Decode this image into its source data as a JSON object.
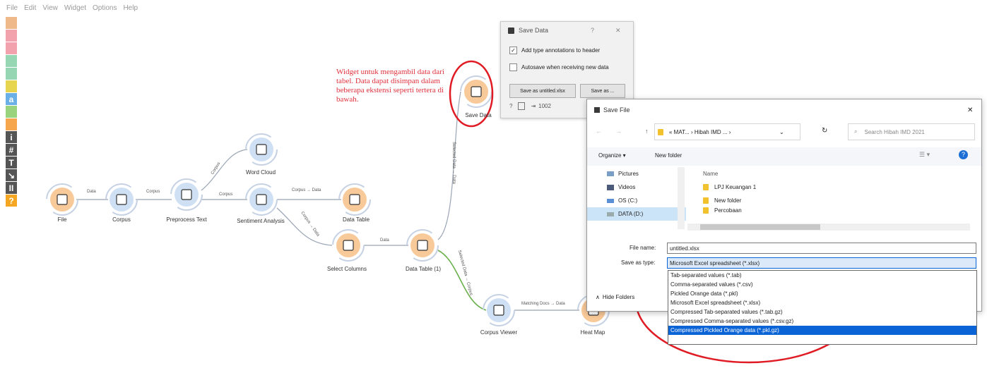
{
  "menu": [
    "File",
    "Edit",
    "View",
    "Widget",
    "Options",
    "Help"
  ],
  "toolbar_icons": [
    {
      "name": "table-icon",
      "color": "#f0b98a"
    },
    {
      "name": "draw-icon",
      "color": "#f1a2ac"
    },
    {
      "name": "hierarchy-icon",
      "color": "#f1a2ac"
    },
    {
      "name": "heatmap-icon",
      "color": "#96d6b3"
    },
    {
      "name": "tree-icon",
      "color": "#96d6b3"
    },
    {
      "name": "image-icon",
      "color": "#e7d54f"
    },
    {
      "name": "text-a-icon",
      "color": "#6ab0e6",
      "glyph": "a"
    },
    {
      "name": "network-icon",
      "color": "#9ad37e"
    },
    {
      "name": "education-icon",
      "color": "#f6a64c"
    },
    {
      "name": "info-icon",
      "color": "#555",
      "glyph": "i"
    },
    {
      "name": "hash-icon",
      "color": "#555",
      "glyph": "#"
    },
    {
      "name": "text-tool-icon",
      "color": "#555",
      "glyph": "T"
    },
    {
      "name": "arrow-icon",
      "color": "#555",
      "glyph": "↘"
    },
    {
      "name": "pause-icon",
      "color": "#555",
      "glyph": "II"
    },
    {
      "name": "help-icon",
      "color": "#f5a623",
      "glyph": "?"
    }
  ],
  "nodes": {
    "file": "File",
    "corpus": "Corpus",
    "preprocess": "Preprocess Text",
    "wordcloud": "Word Cloud",
    "sentiment": "Sentiment Analysis",
    "datatable": "Data Table",
    "selectcolumns": "Select Columns",
    "datatable1": "Data Table (1)",
    "savedata": "Save Data",
    "corpusviewer": "Corpus Viewer",
    "heatmap": "Heat Map"
  },
  "links": {
    "file_corpus": "Data",
    "corpus_preprocess": "Corpus",
    "preprocess_wordcloud": "Corpus",
    "preprocess_sentiment": "Corpus",
    "sentiment_datatable": "Corpus → Data",
    "sentiment_select": "Corpus → Data",
    "select_datatable1": "Data",
    "datatable1_savedata": "Selected Data → Data",
    "datatable1_corpusviewer": "Selected Data → Corpus",
    "corpusviewer_heatmap": "Matching Docs → Data"
  },
  "annotation": "Widget untuk mengambil data dari tabel. Data dapat disimpan dalam beberapa ekstensi seperti tertera di bawah.",
  "save_data": {
    "title": "Save Data",
    "help": "?",
    "close": "✕",
    "opt1": "Add type annotations to header",
    "opt2": "Autosave when receiving new data",
    "btn_save_as_untitled": "Save as untitled.xlsx",
    "btn_save_as": "Save as ...",
    "status_count": "1002"
  },
  "save_file": {
    "title": "Save File",
    "close": "✕",
    "path": "« MAT... › Hibah IMD ... ›",
    "search_placeholder": "Search Hibah IMD 2021",
    "organize": "Organize ▾",
    "new_folder": "New folder",
    "nav": [
      "Pictures",
      "Videos",
      "OS (C:)",
      "DATA (D:)"
    ],
    "col_name": "Name",
    "files": [
      "LPJ Keuangan 1",
      "New folder",
      "Percobaan"
    ],
    "filename_label": "File name:",
    "filename_value": "untitled.xlsx",
    "savetype_label": "Save as type:",
    "savetype_value": "Microsoft Excel spreadsheet (*.xlsx)",
    "hide_folders": "Hide Folders",
    "types": [
      "Tab-separated values (*.tab)",
      "Comma-separated values (*.csv)",
      "Pickled Orange data (*.pkl)",
      "Microsoft Excel spreadsheet (*.xlsx)",
      "Compressed Tab-separated values (*.tab.gz)",
      "Compressed Comma-separated values (*.csv.gz)",
      "Compressed Pickled Orange data (*.pkl.gz)"
    ],
    "selected_type_index": 6
  },
  "colors": {
    "annotation_red": "#e0313d",
    "node_orange": "#f8c999",
    "node_blue": "#cfe0f5",
    "link_green": "#6ab04c",
    "selection_blue": "#0a64d6"
  }
}
